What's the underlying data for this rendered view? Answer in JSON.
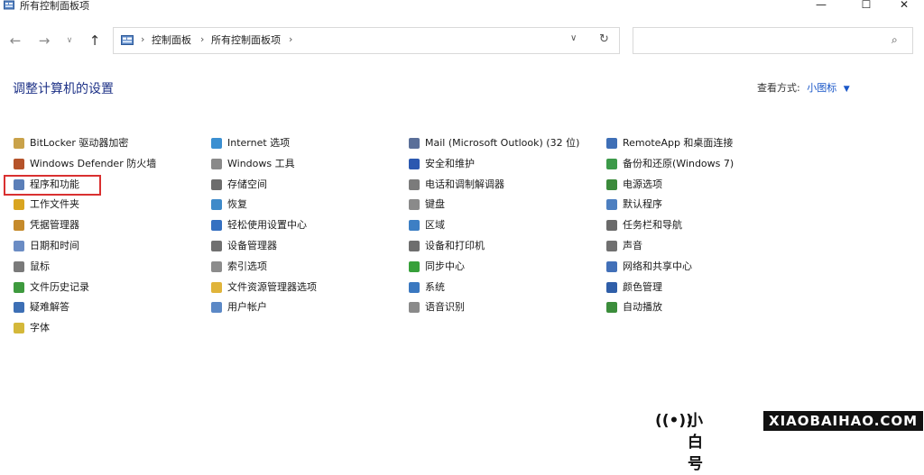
{
  "window": {
    "title": "所有控制面板项",
    "minimize_glyph": "—",
    "maximize_glyph": "☐",
    "close_glyph": "✕"
  },
  "nav": {
    "back_glyph": "←",
    "forward_glyph": "→",
    "recent_glyph": "∨",
    "up_glyph": "↑",
    "breadcrumbs": [
      "控制面板",
      "所有控制面板项"
    ],
    "separator": "›",
    "dropdown_glyph": "∨",
    "refresh_glyph": "↻",
    "search_placeholder": "",
    "search_glyph": "⌕"
  },
  "header": {
    "title": "调整计算机的设置",
    "view_by_label": "查看方式:",
    "view_by_value": "小图标",
    "view_by_caret": "▼"
  },
  "columns": [
    [
      {
        "label": "BitLocker 驱动器加密",
        "icon": "bitlocker-icon",
        "color": "#c9a24a"
      },
      {
        "label": "Windows Defender 防火墙",
        "icon": "firewall-icon",
        "color": "#b5532a"
      },
      {
        "label": "程序和功能",
        "icon": "programs-icon",
        "color": "#5b7fb8"
      },
      {
        "label": "工作文件夹",
        "icon": "work-folders-icon",
        "color": "#d9a520"
      },
      {
        "label": "凭据管理器",
        "icon": "credential-icon",
        "color": "#c58a2b"
      },
      {
        "label": "日期和时间",
        "icon": "clock-icon",
        "color": "#6b8cc4"
      },
      {
        "label": "鼠标",
        "icon": "mouse-icon",
        "color": "#7a7a7a"
      },
      {
        "label": "文件历史记录",
        "icon": "file-history-icon",
        "color": "#3e9a3e"
      },
      {
        "label": "疑难解答",
        "icon": "troubleshoot-icon",
        "color": "#3d6fb5"
      },
      {
        "label": "字体",
        "icon": "font-icon",
        "color": "#d4b83a"
      }
    ],
    [
      {
        "label": "Internet 选项",
        "icon": "internet-options-icon",
        "color": "#3b8fd1"
      },
      {
        "label": "Windows 工具",
        "icon": "windows-tools-icon",
        "color": "#8a8a8a"
      },
      {
        "label": "存储空间",
        "icon": "storage-icon",
        "color": "#6d6d6d"
      },
      {
        "label": "恢复",
        "icon": "recovery-icon",
        "color": "#3f8ac9"
      },
      {
        "label": "轻松使用设置中心",
        "icon": "ease-of-access-icon",
        "color": "#3570c1"
      },
      {
        "label": "设备管理器",
        "icon": "device-manager-icon",
        "color": "#707070"
      },
      {
        "label": "索引选项",
        "icon": "indexing-icon",
        "color": "#8c8c8c"
      },
      {
        "label": "文件资源管理器选项",
        "icon": "folder-options-icon",
        "color": "#e0b43a"
      },
      {
        "label": "用户帐户",
        "icon": "user-accounts-icon",
        "color": "#5b88c6"
      }
    ],
    [
      {
        "label": "Mail (Microsoft Outlook) (32 位)",
        "icon": "mail-icon",
        "color": "#5a6f99"
      },
      {
        "label": "安全和维护",
        "icon": "flag-icon",
        "color": "#2b58b0"
      },
      {
        "label": "电话和调制解调器",
        "icon": "phone-modem-icon",
        "color": "#7b7b7b"
      },
      {
        "label": "键盘",
        "icon": "keyboard-icon",
        "color": "#8a8a8a"
      },
      {
        "label": "区域",
        "icon": "region-icon",
        "color": "#3d7fc4"
      },
      {
        "label": "设备和打印机",
        "icon": "printer-icon",
        "color": "#6e6e6e"
      },
      {
        "label": "同步中心",
        "icon": "sync-icon",
        "color": "#37a03a"
      },
      {
        "label": "系统",
        "icon": "system-icon",
        "color": "#3a78c0"
      },
      {
        "label": "语音识别",
        "icon": "microphone-icon",
        "color": "#8a8a8a"
      }
    ],
    [
      {
        "label": "RemoteApp 和桌面连接",
        "icon": "remoteapp-icon",
        "color": "#3e6fb6"
      },
      {
        "label": "备份和还原(Windows 7)",
        "icon": "backup-icon",
        "color": "#3c9a49"
      },
      {
        "label": "电源选项",
        "icon": "power-icon",
        "color": "#3b8a3b"
      },
      {
        "label": "默认程序",
        "icon": "default-programs-icon",
        "color": "#4d7fc0"
      },
      {
        "label": "任务栏和导航",
        "icon": "taskbar-icon",
        "color": "#6a6a6a"
      },
      {
        "label": "声音",
        "icon": "speaker-icon",
        "color": "#707070"
      },
      {
        "label": "网络和共享中心",
        "icon": "network-icon",
        "color": "#4270b8"
      },
      {
        "label": "颜色管理",
        "icon": "color-management-icon",
        "color": "#2f5ea8"
      },
      {
        "label": "自动播放",
        "icon": "autoplay-icon",
        "color": "#3b8d3b"
      }
    ]
  ],
  "watermark": {
    "signal_glyph": "((•))",
    "cn_text": "小白号",
    "en_text": "XIAOBAIHAO.COM"
  }
}
